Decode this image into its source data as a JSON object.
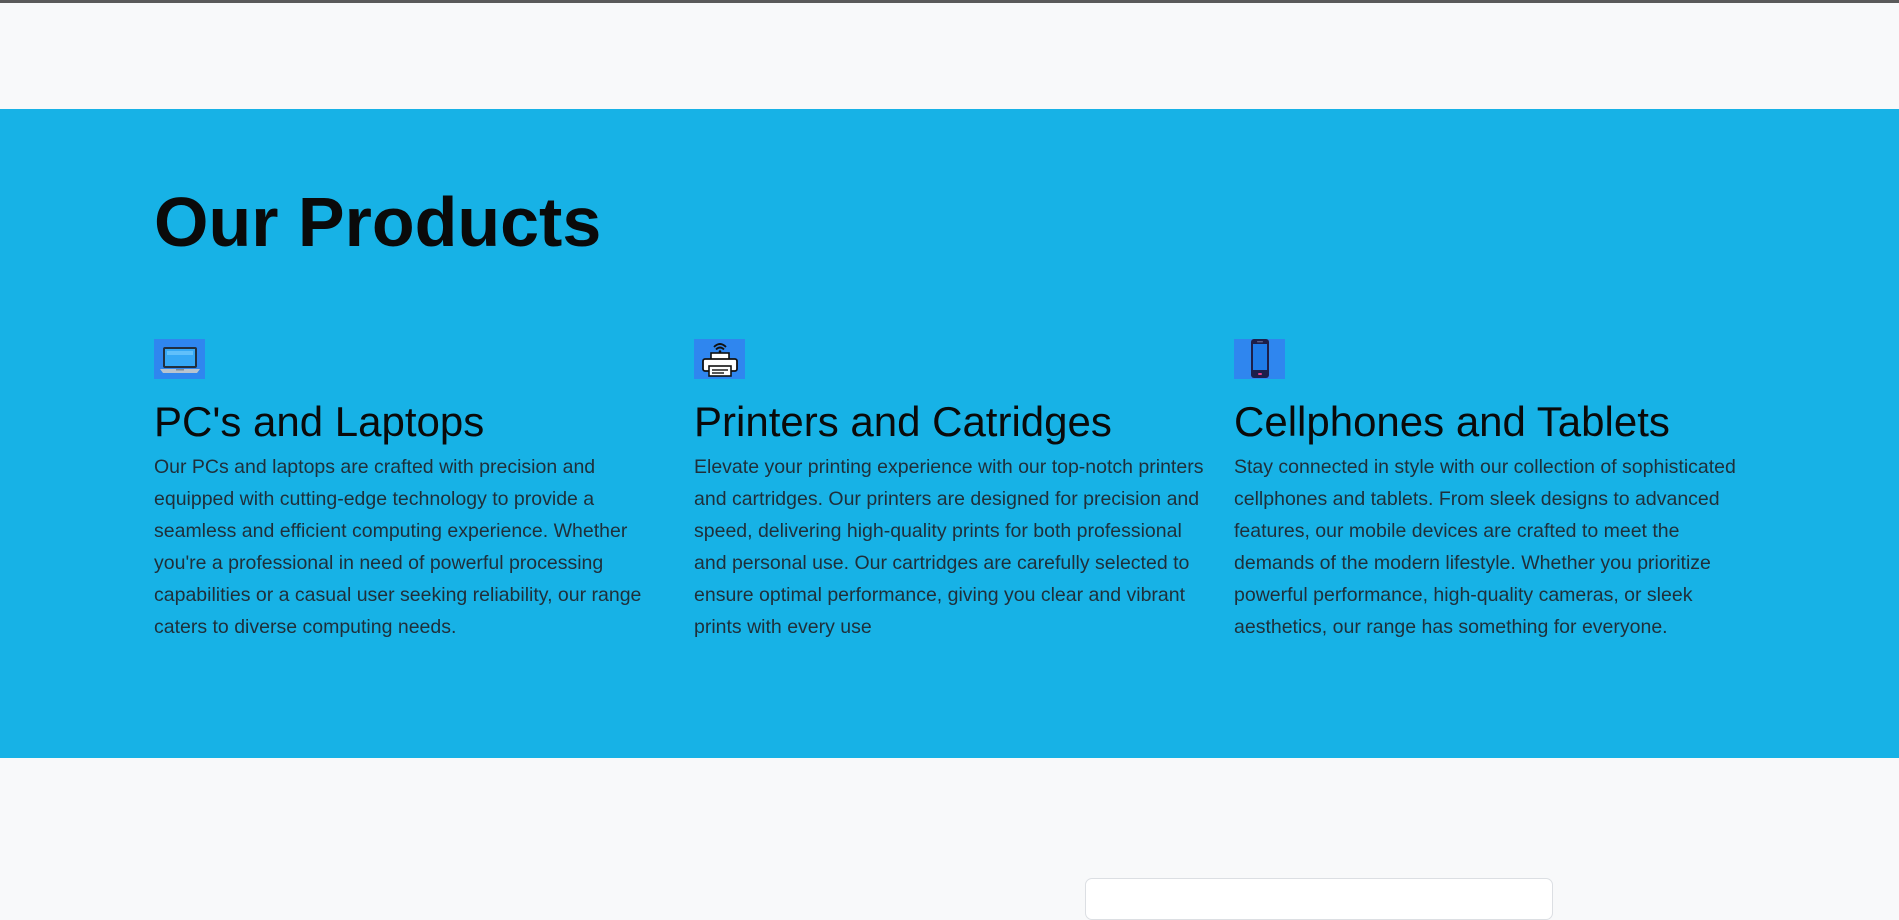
{
  "products": {
    "title": "Our Products",
    "background_color": "#17b2e6",
    "items": [
      {
        "icon": "laptop-icon",
        "title": "PC's and Laptops",
        "description": "Our PCs and laptops are crafted with precision and equipped with cutting-edge technology to provide a seamless and efficient computing experience. Whether you're a professional in need of powerful processing capabilities or a casual user seeking reliability, our range caters to diverse computing needs."
      },
      {
        "icon": "printer-icon",
        "title": "Printers and Catridges",
        "description": "Elevate your printing experience with our top-notch printers and cartridges. Our printers are designed for precision and speed, delivering high-quality prints for both professional and personal use. Our cartridges are carefully selected to ensure optimal performance, giving you clear and vibrant prints with every use"
      },
      {
        "icon": "tablet-icon",
        "title": "Cellphones and Tablets",
        "description": "Stay connected in style with our collection of sophisticated cellphones and tablets. From sleek designs to advanced features, our mobile devices are crafted to meet the demands of the modern lifestyle. Whether you prioritize powerful performance, high-quality cameras, or sleek aesthetics, our range has something for everyone."
      }
    ]
  }
}
